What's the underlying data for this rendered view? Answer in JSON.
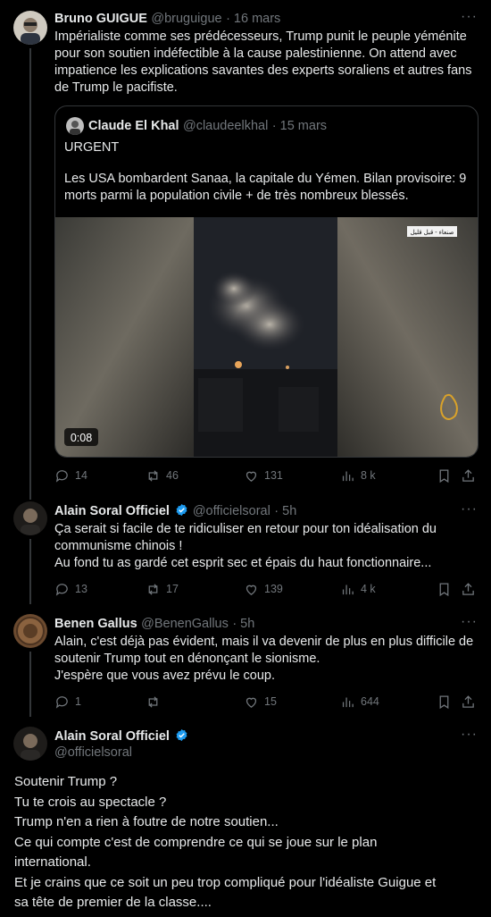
{
  "post1": {
    "author": "Bruno GUIGUE",
    "handle": "@bruguigue",
    "time": "· 16 mars",
    "text_lines": [
      "Impérialiste comme ses prédécesseurs, Trump punit le peuple yéménite",
      "pour son soutien indéfectible à la cause palestinienne. On attend avec",
      "impatience les explications savantes des experts soraliens et autres fans",
      "de Trump le pacifiste."
    ],
    "quote": {
      "author": "Claude El Khal",
      "handle": "@claudeelkhal",
      "time": "· 15 mars",
      "line1": "URGENT",
      "text_lines": [
        "Les USA bombardent Sanaa, la capitale du Yémen. Bilan provisoire: 9",
        "morts parmi la population civile + de très nombreux blessés."
      ],
      "video_duration": "0:08",
      "video_tag": "صنعاء - قبل قليل"
    },
    "stats": {
      "replies": "14",
      "reposts": "46",
      "likes": "131",
      "views": "8 k"
    }
  },
  "post2": {
    "author": "Alain Soral Officiel",
    "handle": "@officielsoral",
    "time": "· 5h",
    "text_lines": [
      "Ça serait si facile de te ridiculiser en retour pour ton idéalisation du",
      "communisme chinois !",
      "Au fond tu as gardé cet esprit sec et épais du haut fonctionnaire..."
    ],
    "stats": {
      "replies": "13",
      "reposts": "17",
      "likes": "139",
      "views": "4 k"
    }
  },
  "post3": {
    "author": "Benen Gallus",
    "handle": "@BenenGallus",
    "time": "· 5h",
    "text_lines": [
      "Alain, c'est déjà pas évident, mais il va devenir de plus en plus difficile de",
      "soutenir Trump tout en dénonçant le sionisme.",
      "J'espère que vous avez prévu le coup."
    ],
    "stats": {
      "replies": "1",
      "reposts": "",
      "likes": "15",
      "views": "644"
    }
  },
  "post4": {
    "author": "Alain Soral Officiel",
    "handle": "@officielsoral",
    "text_lines": [
      "Soutenir Trump ?",
      "Tu te crois au spectacle ?",
      "Trump n'en a rien à foutre de notre soutien...",
      "Ce qui compte c'est de comprendre ce qui se joue sur le plan",
      "international.",
      "Et je crains que ce soit un peu trop compliqué pour l'idéaliste Guigue et",
      "sa tête de premier de la classe...."
    ]
  },
  "icons": {
    "more": "more-horizontal-icon",
    "reply": "reply-icon",
    "repost": "repost-icon",
    "like": "like-icon",
    "views": "views-icon",
    "bookmark": "bookmark-icon",
    "share": "share-icon",
    "verified": "verified-badge-icon"
  },
  "colors": {
    "verified": "#1d9bf0",
    "muted": "#71767b",
    "text": "#e7e9ea",
    "background": "#000000"
  }
}
